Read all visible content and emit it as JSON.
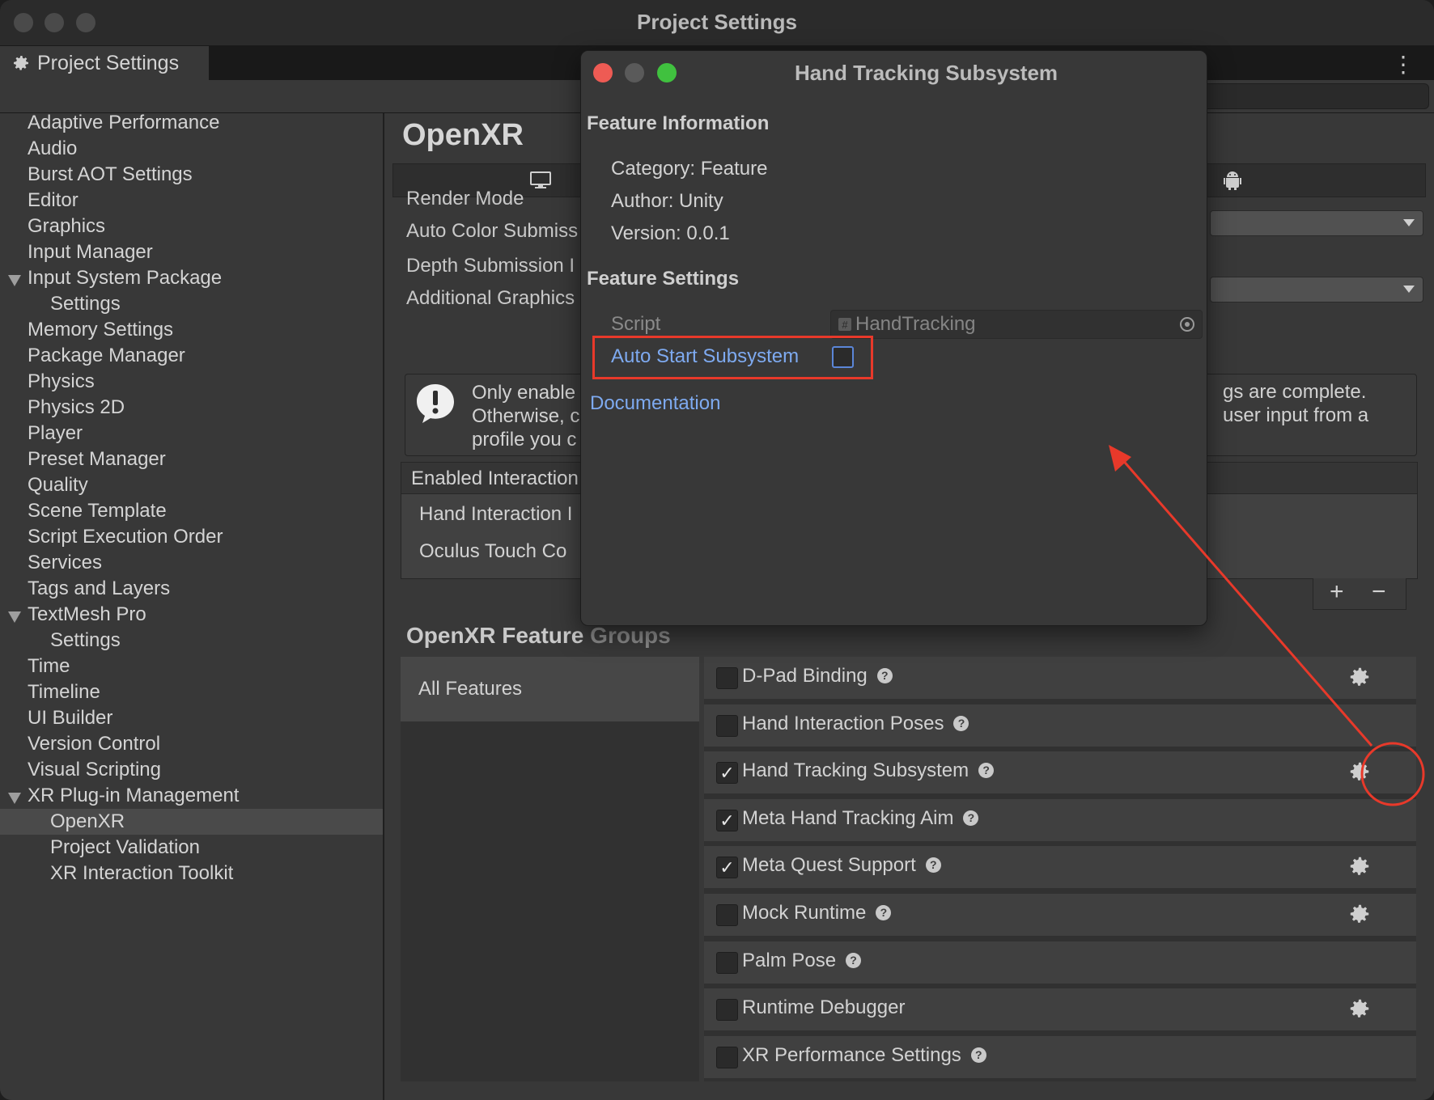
{
  "window": {
    "title": "Project Settings"
  },
  "tab": {
    "label": "Project Settings"
  },
  "sidebar": {
    "items": [
      {
        "label": "Adaptive Performance",
        "level": 0,
        "expanded": false
      },
      {
        "label": "Audio",
        "level": 0,
        "expanded": false
      },
      {
        "label": "Burst AOT Settings",
        "level": 0,
        "expanded": false
      },
      {
        "label": "Editor",
        "level": 0,
        "expanded": false
      },
      {
        "label": "Graphics",
        "level": 0,
        "expanded": false
      },
      {
        "label": "Input Manager",
        "level": 0,
        "expanded": false
      },
      {
        "label": "Input System Package",
        "level": 0,
        "expanded": true
      },
      {
        "label": "Settings",
        "level": 1,
        "expanded": false
      },
      {
        "label": "Memory Settings",
        "level": 0,
        "expanded": false
      },
      {
        "label": "Package Manager",
        "level": 0,
        "expanded": false
      },
      {
        "label": "Physics",
        "level": 0,
        "expanded": false
      },
      {
        "label": "Physics 2D",
        "level": 0,
        "expanded": false
      },
      {
        "label": "Player",
        "level": 0,
        "expanded": false
      },
      {
        "label": "Preset Manager",
        "level": 0,
        "expanded": false
      },
      {
        "label": "Quality",
        "level": 0,
        "expanded": false
      },
      {
        "label": "Scene Template",
        "level": 0,
        "expanded": false
      },
      {
        "label": "Script Execution Order",
        "level": 0,
        "expanded": false
      },
      {
        "label": "Services",
        "level": 0,
        "expanded": false
      },
      {
        "label": "Tags and Layers",
        "level": 0,
        "expanded": false
      },
      {
        "label": "TextMesh Pro",
        "level": 0,
        "expanded": true
      },
      {
        "label": "Settings",
        "level": 1,
        "expanded": false
      },
      {
        "label": "Time",
        "level": 0,
        "expanded": false
      },
      {
        "label": "Timeline",
        "level": 0,
        "expanded": false
      },
      {
        "label": "UI Builder",
        "level": 0,
        "expanded": false
      },
      {
        "label": "Version Control",
        "level": 0,
        "expanded": false
      },
      {
        "label": "Visual Scripting",
        "level": 0,
        "expanded": false
      },
      {
        "label": "XR Plug-in Management",
        "level": 0,
        "expanded": true
      },
      {
        "label": "OpenXR",
        "level": 1,
        "expanded": false,
        "selected": true
      },
      {
        "label": "Project Validation",
        "level": 1,
        "expanded": false
      },
      {
        "label": "XR Interaction Toolkit",
        "level": 1,
        "expanded": false
      }
    ]
  },
  "main": {
    "heading": "OpenXR",
    "platform_tabs": [
      "desktop-icon",
      "android-icon"
    ],
    "fields": {
      "render_mode": "Render Mode",
      "auto_color": "Auto Color Submiss",
      "depth_submission": "Depth Submission I",
      "additional_graphics": "Additional Graphics"
    },
    "warning": {
      "left_lines": [
        "Only enable",
        "Otherwise, c",
        "profile you c"
      ],
      "right_lines": [
        "gs are complete.",
        "user input from a"
      ]
    },
    "profiles": {
      "header": "Enabled Interaction",
      "items": [
        "Hand Interaction I",
        "Oculus Touch Co"
      ],
      "add_label": "+",
      "remove_label": "−"
    },
    "feature_groups": {
      "title_main": "OpenXR Feature",
      "title_dim": "Groups",
      "groups": [
        "All Features"
      ]
    },
    "features": [
      {
        "label": "D-Pad Binding",
        "checked": false,
        "help": true,
        "gear": true
      },
      {
        "label": "Hand Interaction Poses",
        "checked": false,
        "help": true,
        "gear": false
      },
      {
        "label": "Hand Tracking Subsystem",
        "checked": true,
        "help": true,
        "gear": true,
        "highlighted": true
      },
      {
        "label": "Meta Hand Tracking Aim",
        "checked": true,
        "help": true,
        "gear": false
      },
      {
        "label": "Meta Quest Support",
        "checked": true,
        "help": true,
        "gear": true
      },
      {
        "label": "Mock Runtime",
        "checked": false,
        "help": true,
        "gear": true
      },
      {
        "label": "Palm Pose",
        "checked": false,
        "help": true,
        "gear": false
      },
      {
        "label": "Runtime Debugger",
        "checked": false,
        "help": false,
        "gear": true
      },
      {
        "label": "XR Performance Settings",
        "checked": false,
        "help": true,
        "gear": false
      }
    ]
  },
  "popup": {
    "title": "Hand Tracking Subsystem",
    "info_heading": "Feature Information",
    "category": "Category: Feature",
    "author": "Author: Unity",
    "version": "Version: 0.0.1",
    "settings_heading": "Feature Settings",
    "script_label": "Script",
    "script_value": "HandTracking",
    "auto_start_label": "Auto Start Subsystem",
    "auto_start_checked": false,
    "documentation": "Documentation"
  },
  "colors": {
    "annotation": "#e8392a",
    "link": "#7eaaf0",
    "close": "#ee5b54",
    "zoom": "#40c13f"
  }
}
